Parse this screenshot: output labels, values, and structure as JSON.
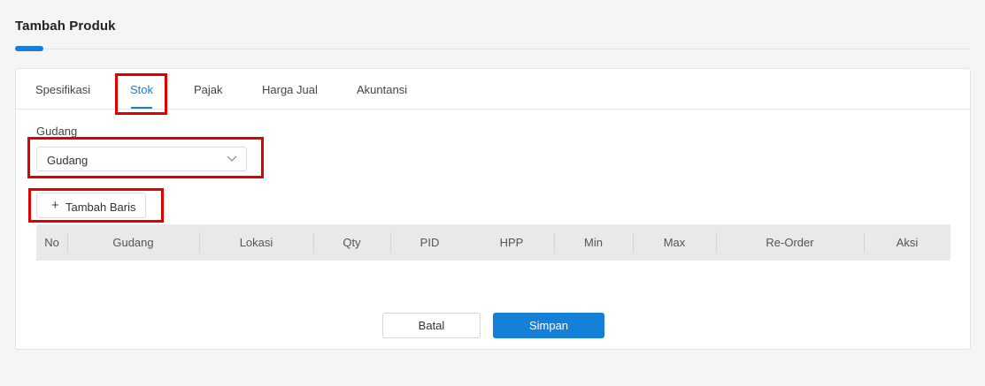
{
  "page": {
    "title": "Tambah Produk"
  },
  "tabs": [
    {
      "label": "Spesifikasi"
    },
    {
      "label": "Stok"
    },
    {
      "label": "Pajak"
    },
    {
      "label": "Harga Jual"
    },
    {
      "label": "Akuntansi"
    }
  ],
  "active_tab": "Stok",
  "warehouse": {
    "label": "Gudang",
    "selected": "Gudang"
  },
  "add_row": {
    "label": "Tambah Baris"
  },
  "table": {
    "columns": [
      "No",
      "Gudang",
      "Lokasi",
      "Qty",
      "PID",
      "HPP",
      "Min",
      "Max",
      "Re-Order",
      "Aksi"
    ]
  },
  "actions": {
    "cancel": "Batal",
    "save": "Simpan"
  },
  "colors": {
    "accent": "#1580d8",
    "highlight": "#e00000"
  }
}
